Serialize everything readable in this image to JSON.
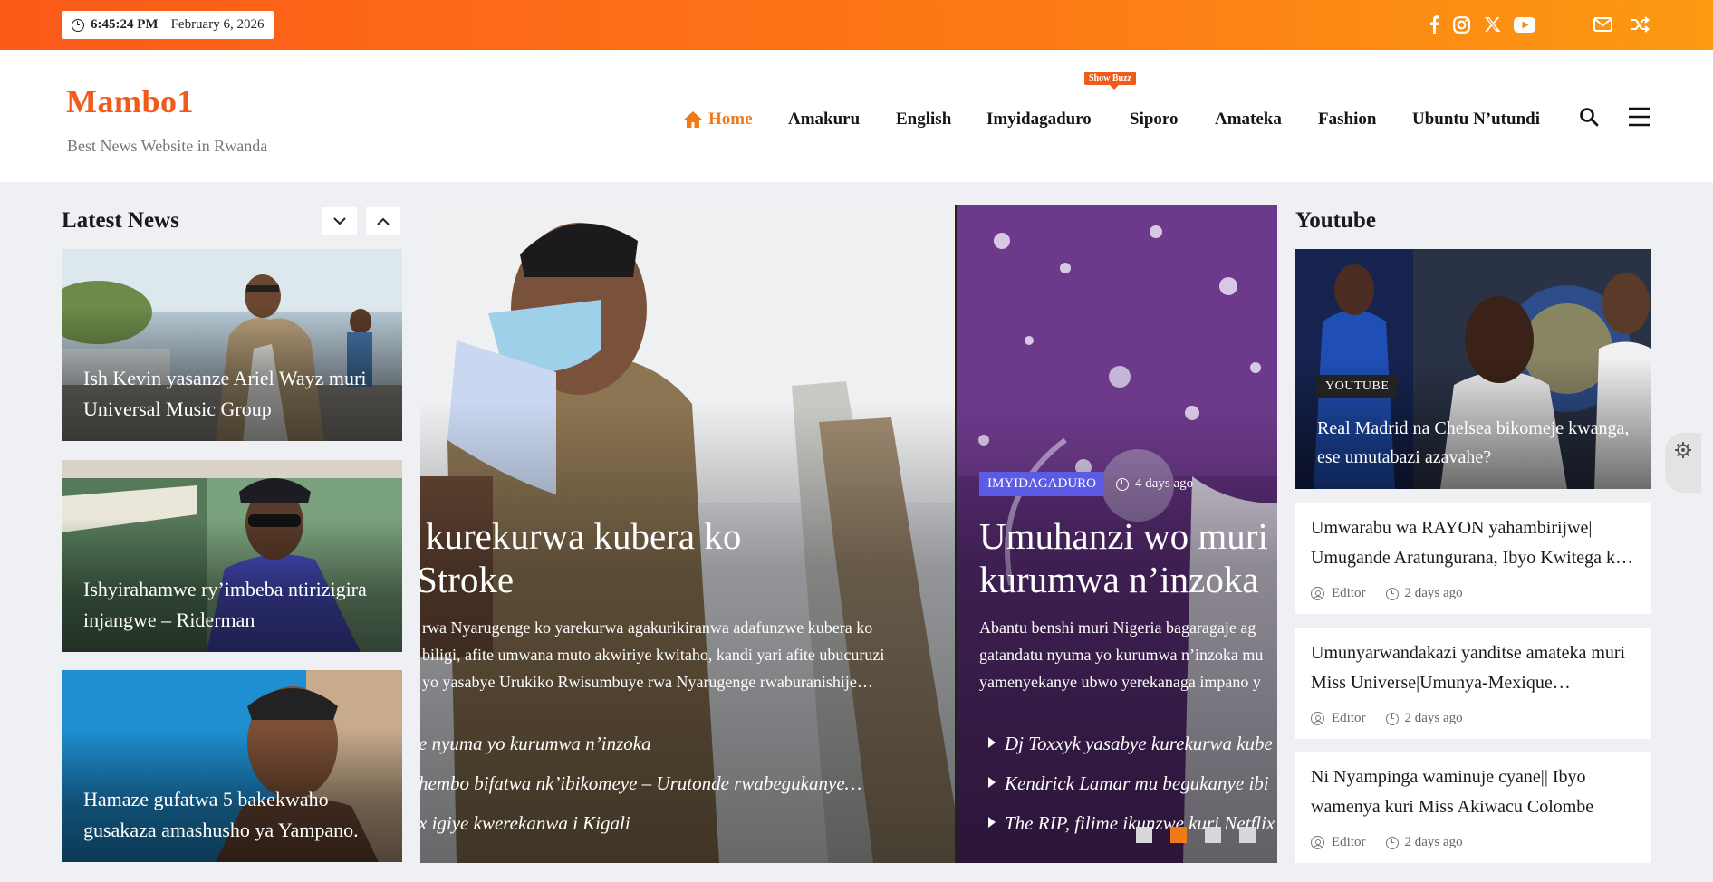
{
  "topbar": {
    "time": "6:45:24 PM",
    "date": "February 6, 2026",
    "social_icons": [
      "facebook-icon",
      "instagram-icon",
      "x-icon",
      "youtube-icon"
    ],
    "util_icons": [
      "mail-icon",
      "shuffle-icon"
    ],
    "gradient": [
      "#fb5a19",
      "#fc9a12"
    ]
  },
  "header": {
    "logo": "Mambo1",
    "tagline": "Best News Website in Rwanda",
    "nav": [
      {
        "label": "Home",
        "active": true
      },
      {
        "label": "Amakuru"
      },
      {
        "label": "English"
      },
      {
        "label": "Imyidagaduro",
        "badge": "Show Buzz"
      },
      {
        "label": "Siporo"
      },
      {
        "label": "Amateka"
      },
      {
        "label": "Fashion"
      },
      {
        "label": "Ubuntu N’utundi"
      }
    ],
    "accent": "#f07a18"
  },
  "latest": {
    "title": "Latest News",
    "items": [
      {
        "title": "Ish Kevin yasanze Ariel Wayz muri Universal Music Group"
      },
      {
        "title": "Ishyirahamwe ry’imbeba ntirizigira injangwe – Riderman"
      },
      {
        "title": "Hamaze gufatwa 5 bakekwaho gusakaza amashusho ya Yampano."
      }
    ]
  },
  "slider": {
    "left": {
      "headline": [
        "kurekurwa kubera ko",
        "Stroke"
      ],
      "excerpt": [
        "rwa Nyarugenge ko yarekurwa agakurikiranwa adafunzwe kubera ko",
        "biligi, afite umwana muto akwiriye kwitaho, kandi yari afite ubucuruzi",
        "yo yasabye Urukiko Rwisumbuye rwa Nyarugenge rwaburanishije…"
      ],
      "related": [
        "e nyuma yo kurumwa n’inzoka",
        "hembo bifatwa nk’ibikomeye – Urutonde rwabegukanye…",
        "x igiye kwerekanwa i Kigali"
      ]
    },
    "right": {
      "category": "IMYIDAGADURO",
      "time": "4 days ago",
      "headline": [
        "Umuhanzi wo muri",
        "kurumwa n’inzoka"
      ],
      "excerpt": [
        "Abantu benshi muri Nigeria bagaragaje ag",
        "gatandatu nyuma yo kurumwa n’inzoka mu",
        "yamenyekanye ubwo yerekanaga impano y"
      ],
      "related": [
        "Dj Toxxyk yasabye kurekurwa kube",
        "Kendrick Lamar mu begukanye ibi",
        "The RIP, filime ikunzwe kuri Netflix"
      ]
    },
    "dots": 4,
    "active_dot": 2
  },
  "youtube": {
    "title": "Youtube",
    "feature": {
      "badge": "YOUTUBE",
      "title": "Real Madrid na Chelsea bikomeje kwanga, ese umutabazi azavahe?"
    },
    "items": [
      {
        "line1": "Umwarabu wa RAYON yahambirijwe|",
        "line2": "Umugande Aratungurana, Ibyo Kwitega k…",
        "author": "Editor",
        "time": "2 days ago"
      },
      {
        "line1": "Umunyarwandakazi yanditse amateka muri",
        "line2": "Miss Universe|Umunya-Mexique…",
        "author": "Editor",
        "time": "2 days ago"
      },
      {
        "line1": "Ni Nyampinga waminuje cyane|| Ibyo",
        "line2": "wamenya kuri Miss Akiwacu Colombe",
        "author": "Editor",
        "time": "2 days ago"
      }
    ]
  }
}
